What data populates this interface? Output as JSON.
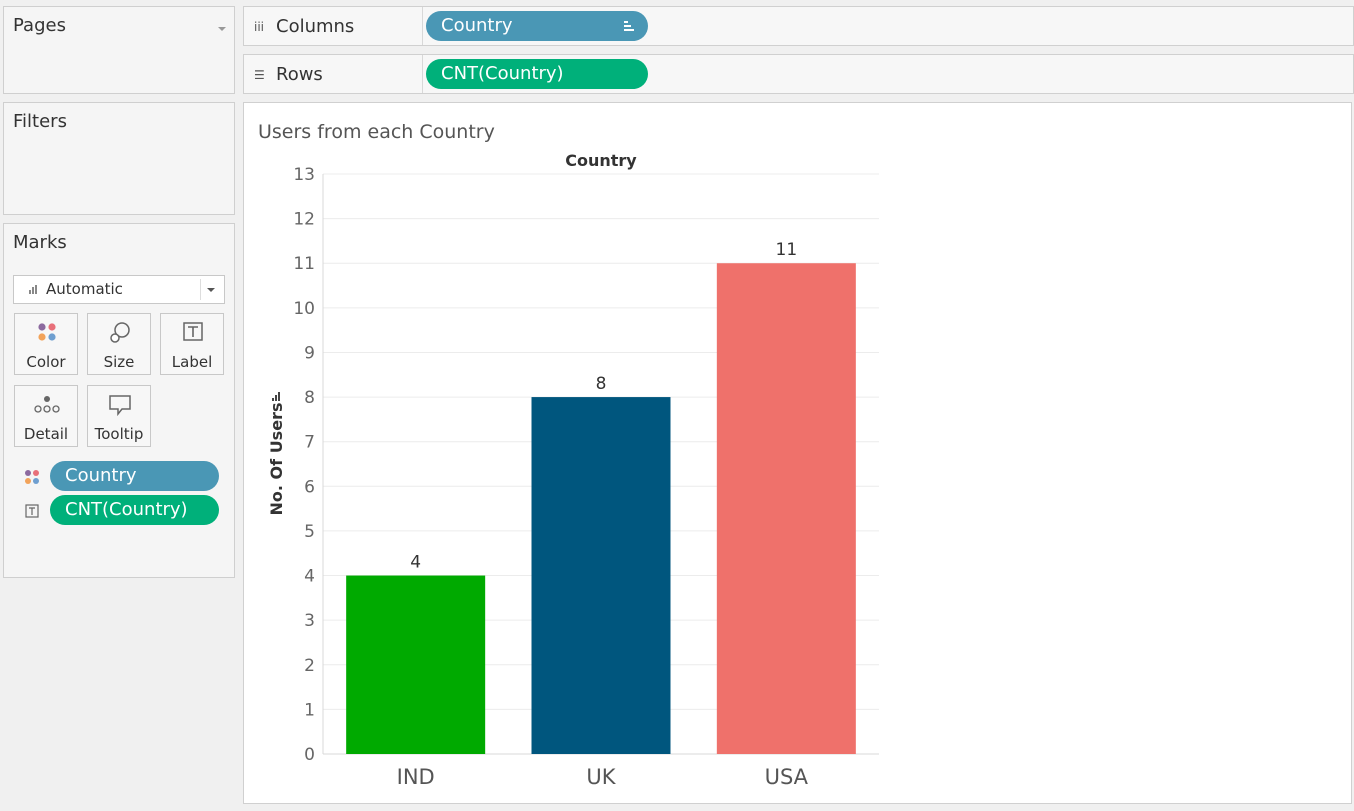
{
  "left": {
    "pages_title": "Pages",
    "filters_title": "Filters",
    "marks_title": "Marks",
    "mark_type": "Automatic",
    "buttons": {
      "color": "Color",
      "size": "Size",
      "label": "Label",
      "detail": "Detail",
      "tooltip": "Tooltip"
    },
    "pills": [
      {
        "label": "Country",
        "encoding": "color"
      },
      {
        "label": "CNT(Country)",
        "encoding": "label"
      }
    ]
  },
  "shelves": {
    "columns": {
      "name": "Columns",
      "pill": "Country"
    },
    "rows": {
      "name": "Rows",
      "pill": "CNT(Country)"
    }
  },
  "viz": {
    "title": "Users from each Country",
    "column_header": "Country"
  },
  "chart_data": {
    "type": "bar",
    "title": "Users from each Country",
    "xlabel": "Country",
    "ylabel": "No. Of Users",
    "categories": [
      "IND",
      "UK",
      "USA"
    ],
    "values": [
      4,
      8,
      11
    ],
    "colors": [
      "#00aa00",
      "#00567e",
      "#ef716b"
    ],
    "ylim": [
      0,
      13
    ],
    "yticks": [
      0,
      1,
      2,
      3,
      4,
      5,
      6,
      7,
      8,
      9,
      10,
      11,
      12,
      13
    ],
    "data_labels": [
      "4",
      "8",
      "11"
    ],
    "grid": true,
    "legend": "none"
  }
}
